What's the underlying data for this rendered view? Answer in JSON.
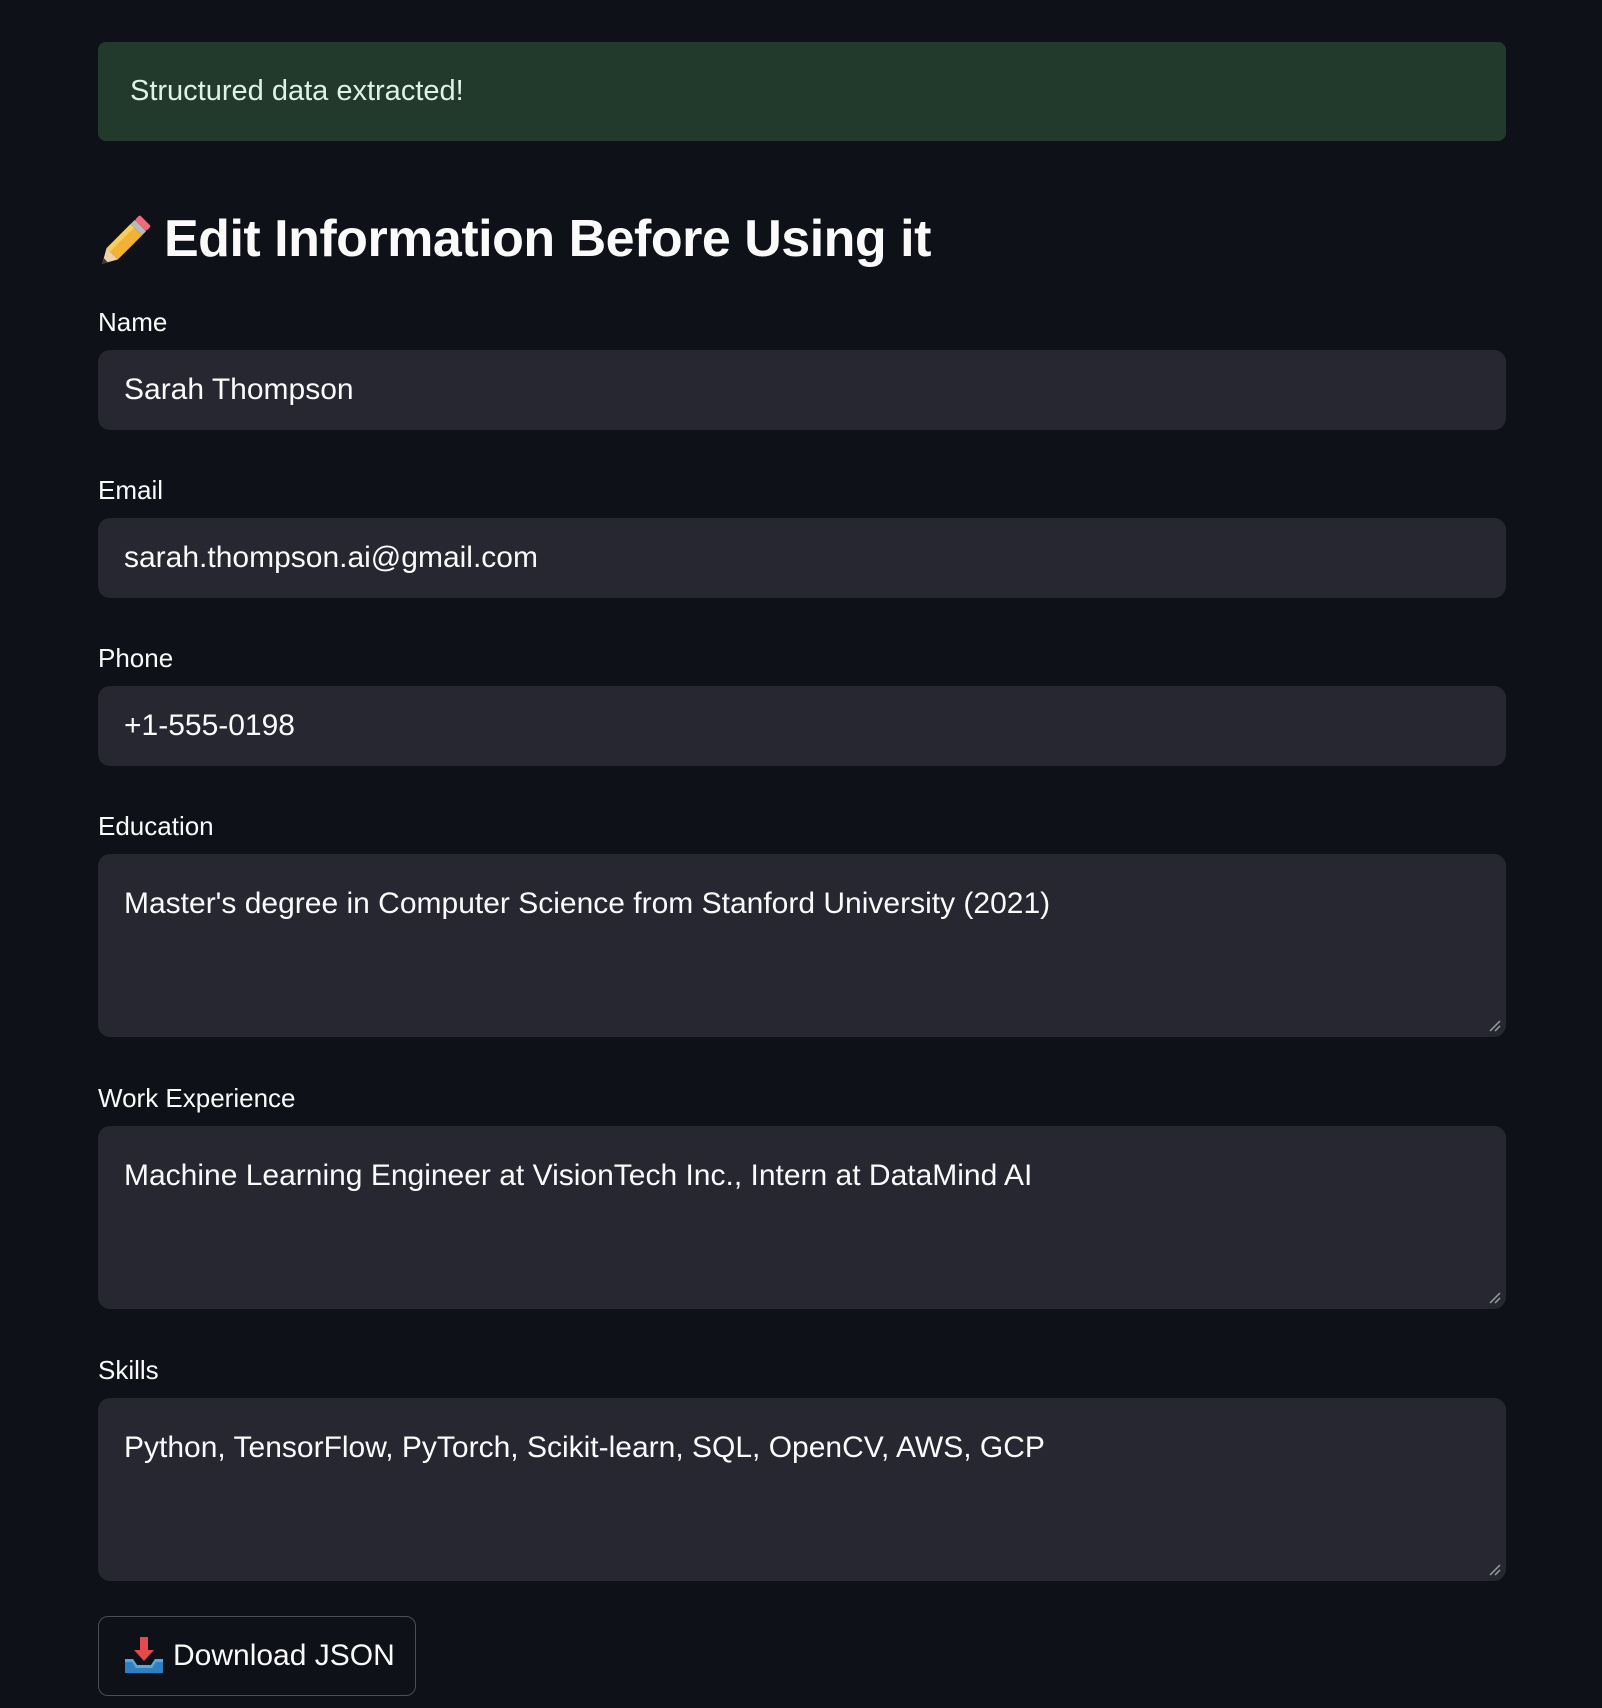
{
  "alert": {
    "text": "Structured data extracted!",
    "color": "#213a2b"
  },
  "heading": {
    "icon": "pencil-icon",
    "text": "Edit Information Before Using it"
  },
  "fields": {
    "name": {
      "label": "Name",
      "value": "Sarah Thompson"
    },
    "email": {
      "label": "Email",
      "value": "sarah.thompson.ai@gmail.com"
    },
    "phone": {
      "label": "Phone",
      "value": "+1-555-0198"
    },
    "education": {
      "label": "Education",
      "value": "Master's degree in Computer Science from Stanford University (2021)"
    },
    "work_experience": {
      "label": "Work Experience",
      "value": "Machine Learning Engineer at VisionTech Inc., Intern at DataMind AI"
    },
    "skills": {
      "label": "Skills",
      "value": "Python, TensorFlow, PyTorch, Scikit-learn, SQL, OpenCV, AWS, GCP"
    }
  },
  "download": {
    "icon": "inbox-tray-icon",
    "label": "Download JSON"
  },
  "colors": {
    "background": "#0e1117",
    "input_background": "#262730",
    "text": "#fafafa"
  }
}
